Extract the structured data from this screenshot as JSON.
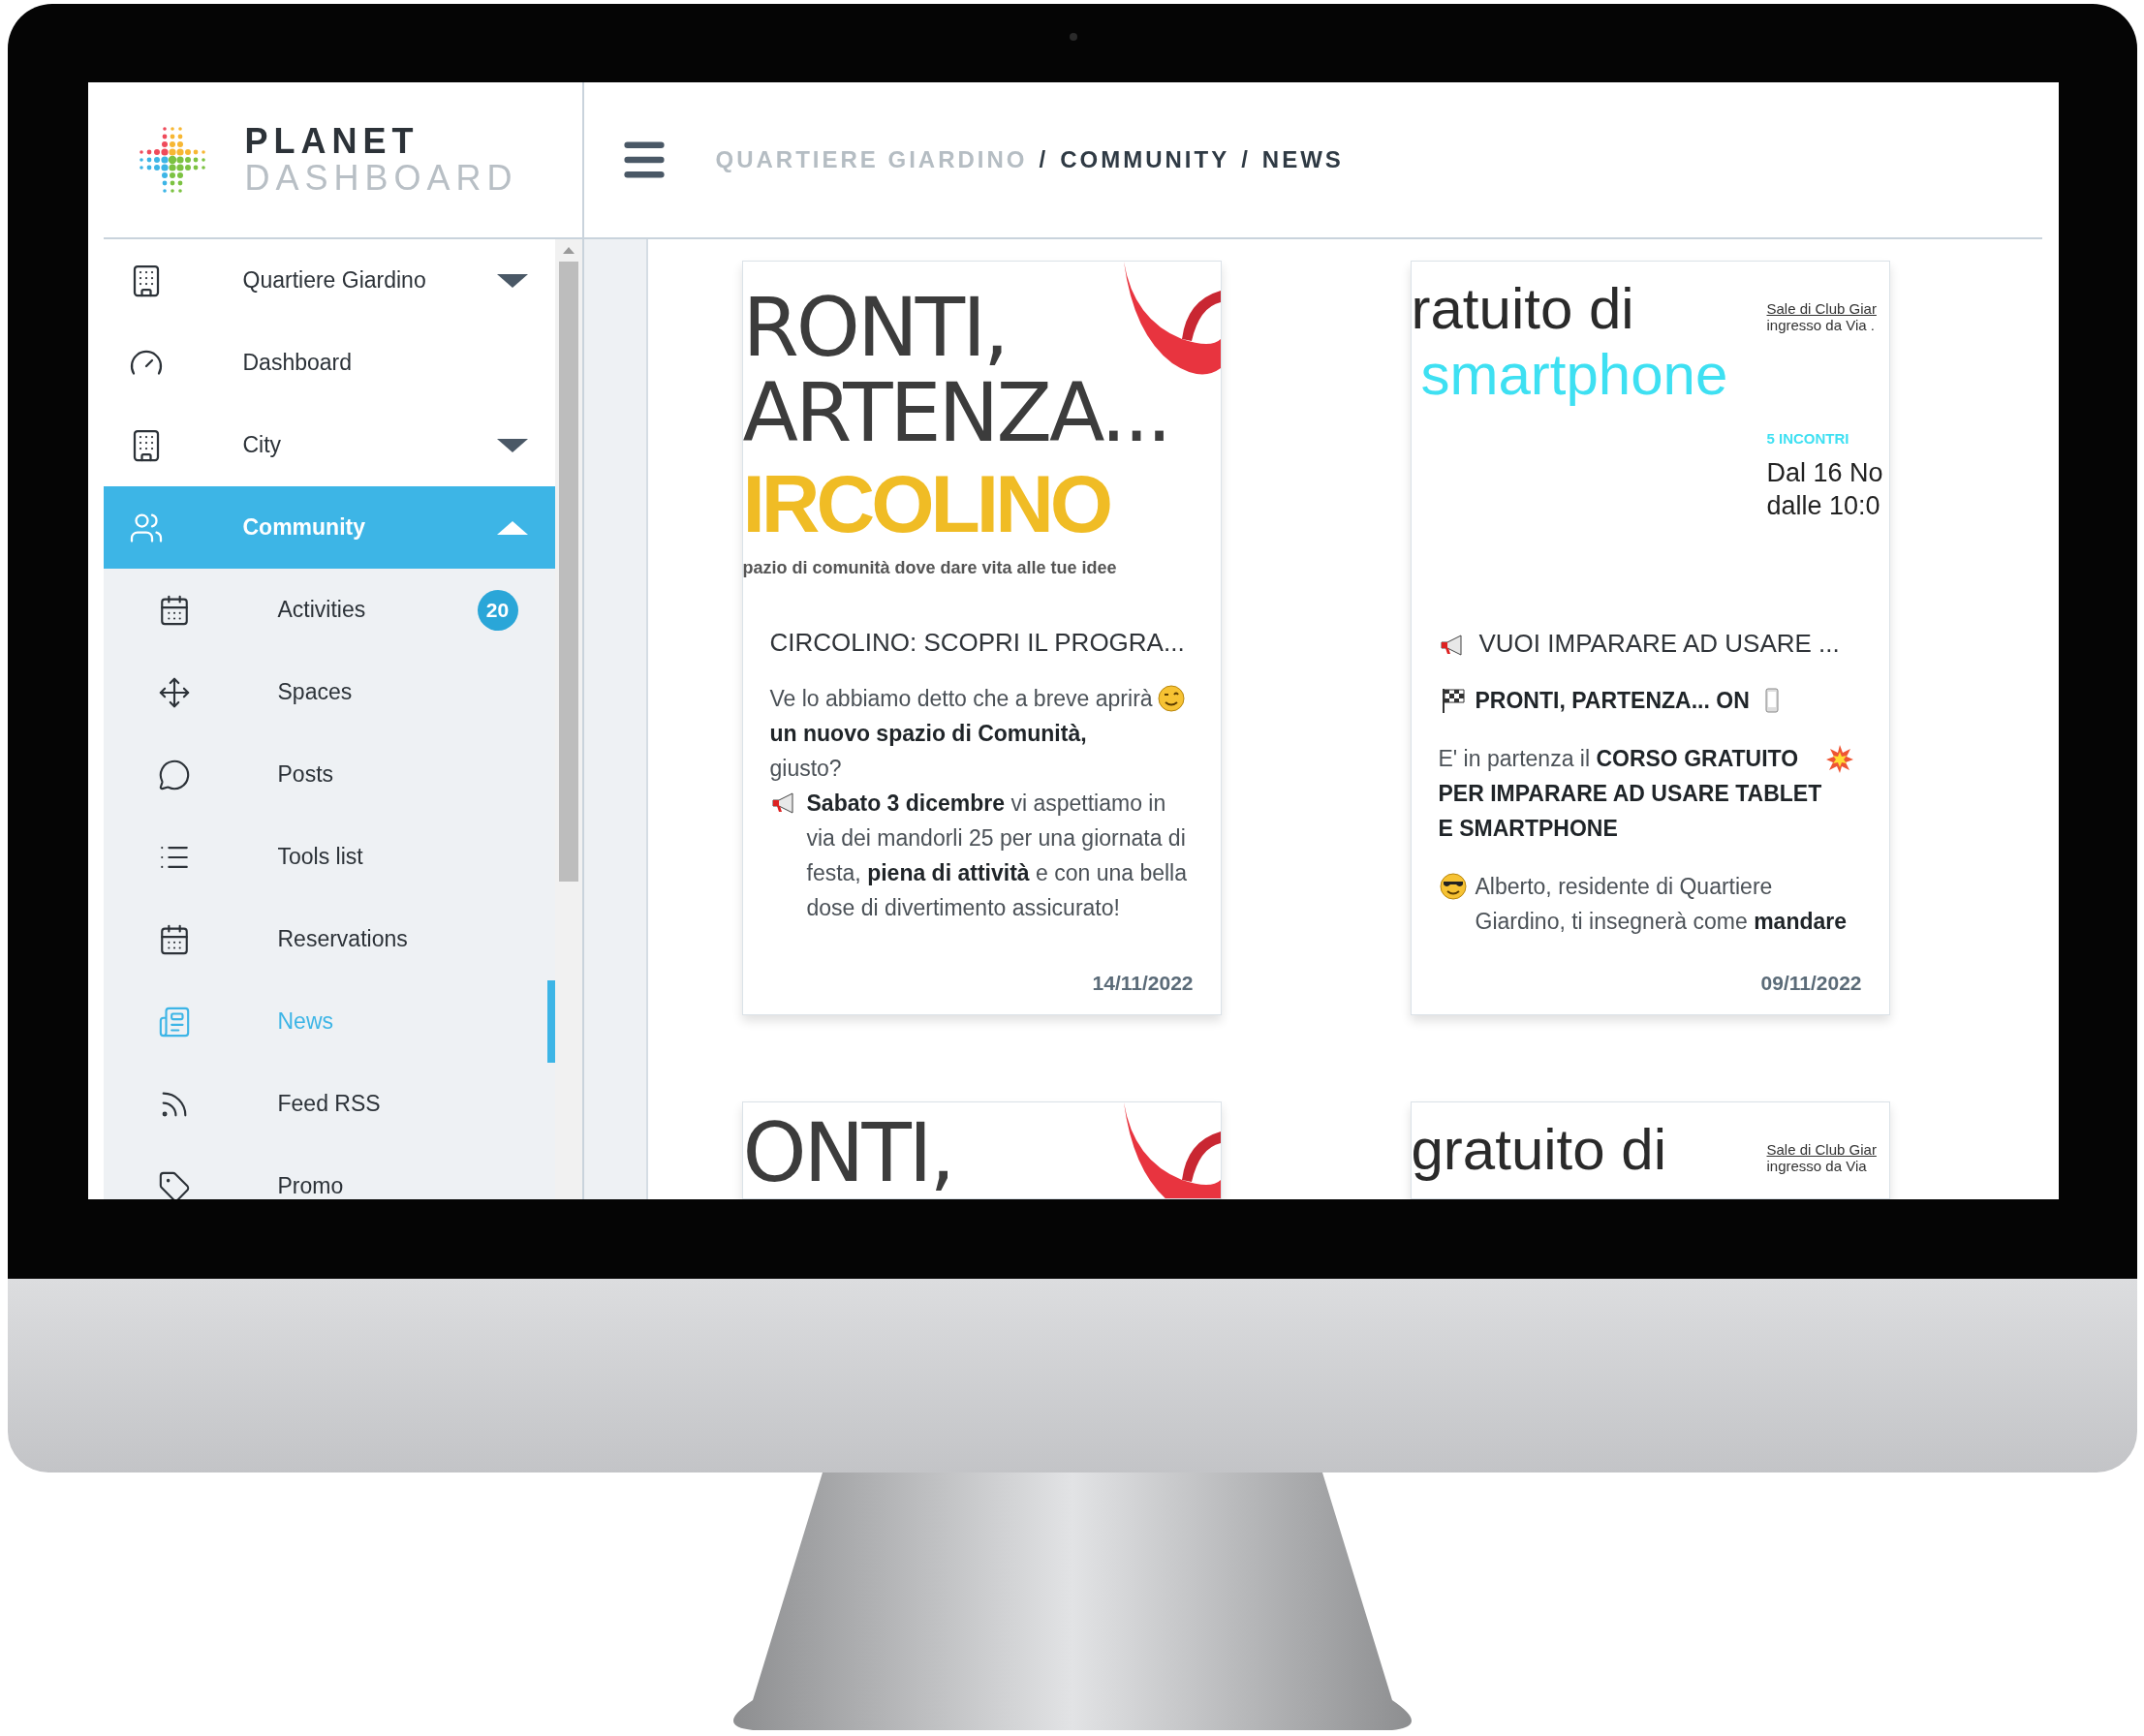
{
  "brand": {
    "line1": "PLANET",
    "line2": "DASHBOARD"
  },
  "breadcrumb": [
    {
      "kind": "crumb",
      "text": "QUARTIERE GIARDINO",
      "muted": true
    },
    {
      "kind": "sep",
      "text": "/"
    },
    {
      "kind": "crumb",
      "text": "COMMUNITY",
      "muted": false
    },
    {
      "kind": "sep",
      "text": "/"
    },
    {
      "kind": "crumb",
      "text": "NEWS",
      "muted": false
    }
  ],
  "sidebar": {
    "items": [
      {
        "label": "Quartiere Giardino",
        "selected": false,
        "expanded": false
      },
      {
        "label": "Dashboard",
        "selected": false
      },
      {
        "label": "City",
        "selected": false,
        "expanded": false
      },
      {
        "label": "Community",
        "selected": true,
        "expanded": true,
        "children": [
          {
            "label": "Activities",
            "selected": false,
            "badge": "20"
          },
          {
            "label": "Spaces",
            "selected": false
          },
          {
            "label": "Posts",
            "selected": false
          },
          {
            "label": "Tools list",
            "selected": false
          },
          {
            "label": "Reservations",
            "selected": false
          },
          {
            "label": "News",
            "selected": true
          },
          {
            "label": "Feed RSS",
            "selected": false
          },
          {
            "label": "Promo",
            "selected": false
          }
        ]
      }
    ]
  },
  "cards": [
    {
      "poster": {
        "kind": "ribbon",
        "lines": [
          {
            "text": "RONTI,",
            "kind": "dark"
          },
          {
            "text": "ARTENZA...",
            "kind": "dark"
          },
          {
            "text": "IRCOLINO",
            "kind": "yellow"
          },
          {
            "text": "pazio di comunità dove dare vita alle tue idee",
            "kind": "caption"
          }
        ]
      },
      "title": [
        {
          "kind": "text",
          "text": "CIRCOLINO: SCOPRI IL PROGRA...",
          "bold": false
        }
      ],
      "body": [
        [
          {
            "kind": "text",
            "text": "Ve lo abbiamo detto che a breve aprirà **un nuovo spazio di Comunità,** giusto?",
            "bold": false
          },
          {
            "kind": "wink"
          },
          {
            "kind": "break"
          },
          {
            "kind": "megaphone"
          },
          {
            "kind": "text",
            "text": "**Sabato 3 dicembre** vi aspettiamo in via dei mandorli 25 per una giornata di festa, **piena di attività** e con una bella dose di divertimento assicurato!",
            "bold": false
          }
        ]
      ],
      "date": "14/11/2022"
    },
    {
      "poster": {
        "kind": "flyer",
        "lines": [
          {
            "text": "ratuito di",
            "kind": "dark"
          },
          {
            "text": "smartphone",
            "kind": "cyan"
          }
        ],
        "notes": [
          {
            "text": "Sale di Club Giar",
            "kind": "link"
          },
          {
            "text": "ingresso da Via .",
            "kind": "small"
          },
          {
            "text": "5 INCONTRI",
            "kind": "label"
          },
          {
            "text": "Dal 16 No",
            "kind": "date"
          },
          {
            "text": "dalle 10:0",
            "kind": "date"
          }
        ]
      },
      "title": [
        {
          "kind": "megaphone"
        },
        {
          "kind": "text",
          "text": "VUOI IMPARARE AD USARE ...",
          "bold": false
        }
      ],
      "body": [
        [
          {
            "kind": "flag"
          },
          {
            "kind": "text",
            "text": "PRONTI, PARTENZA... ON",
            "bold": true
          },
          {
            "kind": "phone"
          }
        ],
        [
          {
            "kind": "text",
            "text": "E' in partenza il **CORSO GRATUITO PER IMPARARE AD USARE TABLET E SMARTPHONE**",
            "bold": false
          },
          {
            "kind": "boom"
          }
        ],
        [
          {
            "kind": "cool"
          },
          {
            "kind": "text",
            "text": "Alberto, residente di Quartiere Giardino, ti insegnerà come **mandare**",
            "bold": false
          }
        ]
      ],
      "date": "09/11/2022"
    },
    {
      "poster": {
        "kind": "ribbon",
        "lines": [
          {
            "text": "ONTI,",
            "kind": "dark"
          }
        ]
      }
    },
    {
      "poster": {
        "kind": "flyer",
        "lines": [
          {
            "text": "gratuito di",
            "kind": "dark"
          }
        ],
        "notes": [
          {
            "text": "Sale di Club Giar",
            "kind": "link"
          },
          {
            "text": "ingresso da Via",
            "kind": "small"
          }
        ]
      }
    }
  ]
}
